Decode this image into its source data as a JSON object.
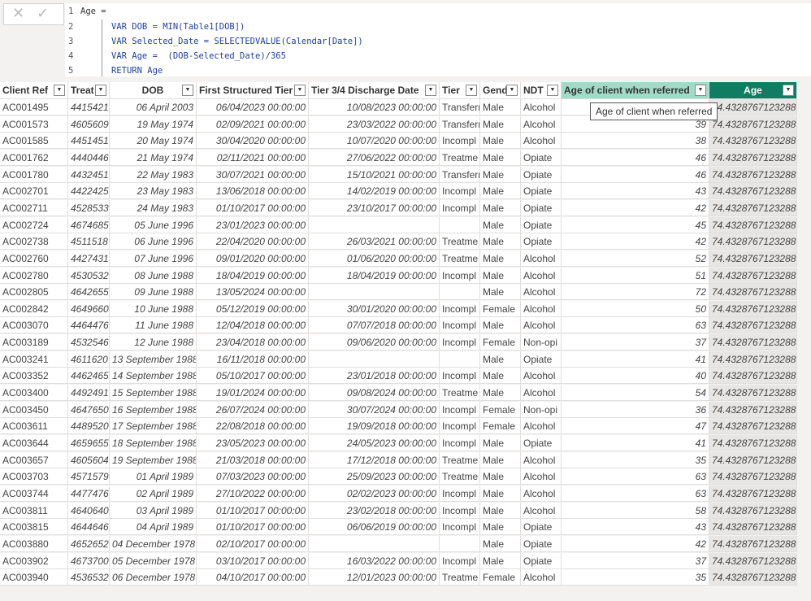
{
  "formula_bar": {
    "cancel_icon": "x-icon",
    "commit_icon": "check-icon",
    "lines": [
      {
        "num": "1",
        "text": "Age ="
      },
      {
        "num": "2",
        "text": "VAR DOB = MIN(Table1[DOB])"
      },
      {
        "num": "3",
        "text": "VAR Selected_Date = SELECTEDVALUE(Calendar[Date])"
      },
      {
        "num": "4",
        "text": "VAR Age =  (DOB-Selected_Date)/365"
      },
      {
        "num": "5",
        "text": "RETURN Age"
      }
    ]
  },
  "colors": {
    "selected_column": "#107c61",
    "related_column": "#9fdcc8"
  },
  "table": {
    "columns": [
      "Client Ref",
      "Treat",
      "DOB",
      "First Structured Tier",
      "Tier 3/4 Discharge Date",
      "Tier",
      "Gend",
      "NDT",
      "Age of client when referred",
      "Age"
    ],
    "tooltip": "Age of client when referred",
    "rows": [
      [
        "AC001495",
        "4415421",
        "06 April 2003",
        "06/04/2023 00:00:00",
        "10/08/2023 00:00:00",
        "Transferr",
        "Male",
        "Alcohol",
        "",
        "74.4328767123288"
      ],
      [
        "AC001573",
        "4605609",
        "19 May 1974",
        "02/09/2021 00:00:00",
        "23/03/2022 00:00:00",
        "Transferr",
        "Male",
        "Alcohol",
        "39",
        "74.4328767123288"
      ],
      [
        "AC001585",
        "4451451",
        "20 May 1974",
        "30/04/2020 00:00:00",
        "10/07/2020 00:00:00",
        "Incompl",
        "Male",
        "Alcohol",
        "38",
        "74.4328767123288"
      ],
      [
        "AC001762",
        "4440446",
        "21 May 1974",
        "02/11/2021 00:00:00",
        "27/06/2022 00:00:00",
        "Treatme",
        "Male",
        "Opiate",
        "46",
        "74.4328767123288"
      ],
      [
        "AC001780",
        "4432451",
        "22 May 1983",
        "30/07/2021 00:00:00",
        "15/10/2021 00:00:00",
        "Transferr",
        "Male",
        "Opiate",
        "46",
        "74.4328767123288"
      ],
      [
        "AC002701",
        "4422425",
        "23 May 1983",
        "13/06/2018 00:00:00",
        "14/02/2019 00:00:00",
        "Incompl",
        "Male",
        "Opiate",
        "43",
        "74.4328767123288"
      ],
      [
        "AC002711",
        "4528533",
        "24 May 1983",
        "01/10/2017 00:00:00",
        "23/10/2017 00:00:00",
        "Incompl",
        "Male",
        "Opiate",
        "42",
        "74.4328767123288"
      ],
      [
        "AC002724",
        "4674685",
        "05 June 1996",
        "23/01/2023 00:00:00",
        "",
        "",
        "Male",
        "Opiate",
        "45",
        "74.4328767123288"
      ],
      [
        "AC002738",
        "4511518",
        "06 June 1996",
        "22/04/2020 00:00:00",
        "26/03/2021 00:00:00",
        "Treatme",
        "Male",
        "Opiate",
        "42",
        "74.4328767123288"
      ],
      [
        "AC002760",
        "4427431",
        "07 June 1996",
        "09/01/2020 00:00:00",
        "01/06/2020 00:00:00",
        "Treatme",
        "Male",
        "Alcohol",
        "52",
        "74.4328767123288"
      ],
      [
        "AC002780",
        "4530532",
        "08 June 1988",
        "18/04/2019 00:00:00",
        "18/04/2019 00:00:00",
        "Incompl",
        "Male",
        "Alcohol",
        "51",
        "74.4328767123288"
      ],
      [
        "AC002805",
        "4642655",
        "09 June 1988",
        "13/05/2024 00:00:00",
        "",
        "",
        "Male",
        "Alcohol",
        "72",
        "74.4328767123288"
      ],
      [
        "AC002842",
        "4649660",
        "10 June 1988",
        "05/12/2019 00:00:00",
        "30/01/2020 00:00:00",
        "Incompl",
        "Female",
        "Alcohol",
        "50",
        "74.4328767123288"
      ],
      [
        "AC003070",
        "4464476",
        "11 June 1988",
        "12/04/2018 00:00:00",
        "07/07/2018 00:00:00",
        "Incompl",
        "Male",
        "Alcohol",
        "63",
        "74.4328767123288"
      ],
      [
        "AC003189",
        "4532546",
        "12 June 1988",
        "23/04/2018 00:00:00",
        "09/06/2020 00:00:00",
        "Incompl",
        "Female",
        "Non-opi",
        "37",
        "74.4328767123288"
      ],
      [
        "AC003241",
        "4611620",
        "13 September 1988",
        "16/11/2018 00:00:00",
        "",
        "",
        "Male",
        "Opiate",
        "41",
        "74.4328767123288"
      ],
      [
        "AC003352",
        "4462465",
        "14 September 1988",
        "05/10/2017 00:00:00",
        "23/01/2018 00:00:00",
        "Incompl",
        "Male",
        "Alcohol",
        "40",
        "74.4328767123288"
      ],
      [
        "AC003400",
        "4492491",
        "15 September 1988",
        "19/01/2024 00:00:00",
        "09/08/2024 00:00:00",
        "Treatme",
        "Male",
        "Alcohol",
        "54",
        "74.4328767123288"
      ],
      [
        "AC003450",
        "4647650",
        "16 September 1988",
        "26/07/2024 00:00:00",
        "30/07/2024 00:00:00",
        "Incompl",
        "Female",
        "Non-opi",
        "36",
        "74.4328767123288"
      ],
      [
        "AC003611",
        "4489520",
        "17 September 1988",
        "22/08/2018 00:00:00",
        "19/09/2018 00:00:00",
        "Incompl",
        "Female",
        "Alcohol",
        "47",
        "74.4328767123288"
      ],
      [
        "AC003644",
        "4659655",
        "18 September 1988",
        "23/05/2023 00:00:00",
        "24/05/2023 00:00:00",
        "Incompl",
        "Male",
        "Opiate",
        "41",
        "74.4328767123288"
      ],
      [
        "AC003657",
        "4605604",
        "19 September 1988",
        "21/03/2018 00:00:00",
        "17/12/2018 00:00:00",
        "Treatme",
        "Male",
        "Alcohol",
        "35",
        "74.4328767123288"
      ],
      [
        "AC003703",
        "4571579",
        "01 April 1989",
        "07/03/2023 00:00:00",
        "25/09/2023 00:00:00",
        "Treatme",
        "Male",
        "Alcohol",
        "63",
        "74.4328767123288"
      ],
      [
        "AC003744",
        "4477476",
        "02 April 1989",
        "27/10/2022 00:00:00",
        "02/02/2023 00:00:00",
        "Incompl",
        "Male",
        "Alcohol",
        "63",
        "74.4328767123288"
      ],
      [
        "AC003811",
        "4640640",
        "03 April 1989",
        "01/10/2017 00:00:00",
        "23/02/2018 00:00:00",
        "Incompl",
        "Male",
        "Alcohol",
        "58",
        "74.4328767123288"
      ],
      [
        "AC003815",
        "4644646",
        "04 April 1989",
        "01/10/2017 00:00:00",
        "06/06/2019 00:00:00",
        "Incompl",
        "Male",
        "Opiate",
        "43",
        "74.4328767123288"
      ],
      [
        "AC003880",
        "4652652",
        "04 December 1978",
        "02/10/2017 00:00:00",
        "",
        "",
        "Male",
        "Opiate",
        "42",
        "74.4328767123288"
      ],
      [
        "AC003902",
        "4673700",
        "05 December 1978",
        "03/10/2017 00:00:00",
        "16/03/2022 00:00:00",
        "Incompl",
        "Male",
        "Opiate",
        "37",
        "74.4328767123288"
      ],
      [
        "AC003940",
        "4536532",
        "06 December 1978",
        "04/10/2017 00:00:00",
        "12/01/2023 00:00:00",
        "Treatme",
        "Female",
        "Alcohol",
        "35",
        "74.4328767123288"
      ]
    ]
  }
}
